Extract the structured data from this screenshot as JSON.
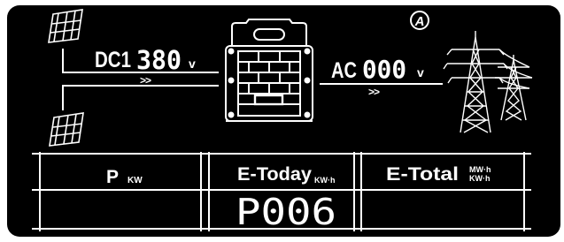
{
  "status": {
    "mode_symbol": "A"
  },
  "dc": {
    "label": "DC1",
    "value": "380",
    "unit": "v",
    "flow": ">>"
  },
  "ac": {
    "label": "AC",
    "value": "000",
    "unit": "v",
    "flow": ">>"
  },
  "table": {
    "power_label": "P",
    "power_unit": "KW",
    "today_label": "E-Today",
    "today_unit": "KW·h",
    "total_label": "E-Total",
    "total_unit_top": "MW·h",
    "total_unit_bottom": "KW·h",
    "power_value": "",
    "today_value": "P006",
    "total_value": ""
  },
  "colors": {
    "background": "#000000",
    "foreground": "#ffffff",
    "page": "#ffffff"
  }
}
